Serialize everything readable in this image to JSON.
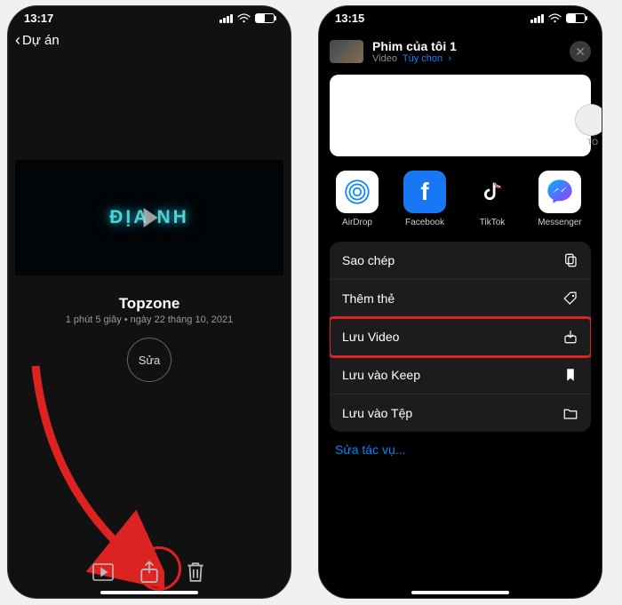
{
  "left": {
    "time": "13:17",
    "back_label": "Dự án",
    "video_overlay_text": "ĐỊA  NH",
    "title": "Topzone",
    "subtitle": "1 phút 5 giây • ngày 22 tháng 10, 2021",
    "edit_label": "Sửa"
  },
  "right": {
    "time": "13:15",
    "sheet_title": "Phim của tôi 1",
    "sheet_subtype": "Video",
    "sheet_options": "Tùy chọn",
    "contact_name": "TO",
    "apps": [
      {
        "label": "AirDrop"
      },
      {
        "label": "Facebook"
      },
      {
        "label": "TikTok"
      },
      {
        "label": "Messenger"
      }
    ],
    "actions": [
      {
        "label": "Sao chép"
      },
      {
        "label": "Thêm thẻ"
      },
      {
        "label": "Lưu Video"
      },
      {
        "label": "Lưu vào Keep"
      },
      {
        "label": "Lưu vào Tệp"
      }
    ],
    "edit_actions": "Sửa tác vụ..."
  }
}
